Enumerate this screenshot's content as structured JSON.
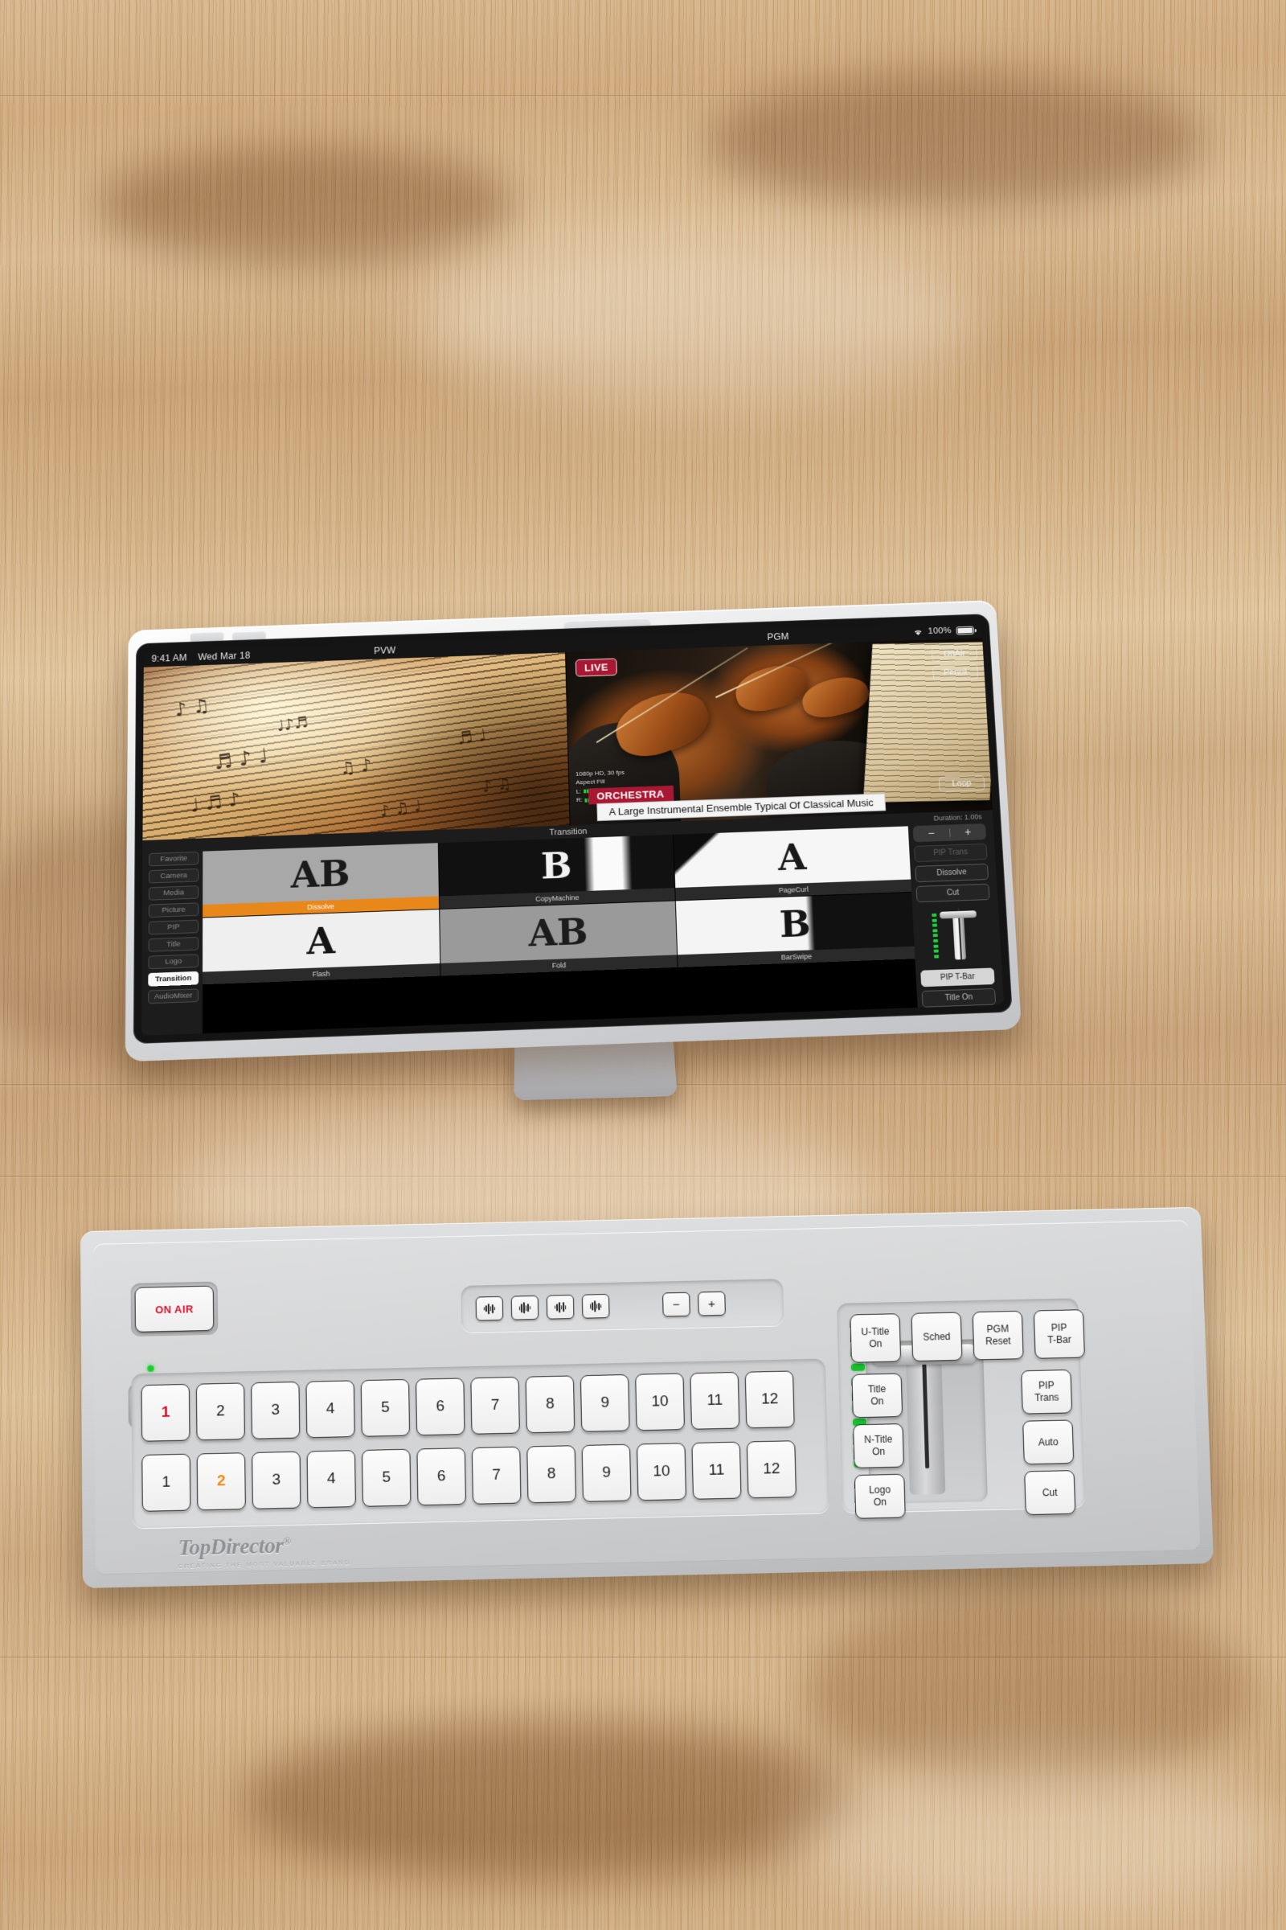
{
  "tablet": {
    "statusbar": {
      "time": "9:41 AM",
      "date": "Wed Mar 18",
      "pvw_label": "PVW",
      "pgm_label": "PGM",
      "battery": "100%",
      "wifi_icon": "wifi-icon",
      "battery_icon": "battery-full-icon"
    },
    "preview": {
      "label": "PVW"
    },
    "program": {
      "live_badge": "LIVE",
      "onair_button": "OnAir",
      "pencil_button": "Pencil",
      "loop_button": "Loop",
      "meta": {
        "format": "1080p HD, 30 fps",
        "aspect": "Aspect Fill",
        "left_channel": "L:",
        "right_channel": "R:"
      },
      "lower_third_title": "ORCHESTRA",
      "lower_third_subtitle": "A Large Instrumental Ensemble Typical Of Classical Music"
    },
    "panel": {
      "title": "Transition",
      "duration_label": "Duration: 1.00s",
      "minus": "−",
      "plus": "+",
      "sidebar": [
        {
          "label": "Favorite",
          "active": false
        },
        {
          "label": "Camera",
          "active": false
        },
        {
          "label": "Media",
          "active": false
        },
        {
          "label": "Picture",
          "active": false
        },
        {
          "label": "PIP",
          "active": false
        },
        {
          "label": "Title",
          "active": false
        },
        {
          "label": "Logo",
          "active": false
        },
        {
          "label": "Transition",
          "active": true
        },
        {
          "label": "AudioMixer",
          "active": false
        }
      ],
      "transitions": [
        {
          "label": "Dissolve",
          "glyph": "AB",
          "selected": true,
          "bg": "#a8a8a8",
          "fg": "#1a1a1a"
        },
        {
          "label": "CopyMachine",
          "glyph": "B",
          "selected": false,
          "bg": "#111111",
          "fg": "#f2f2f2"
        },
        {
          "label": "PageCurl",
          "glyph": "A",
          "selected": false,
          "bg": "#0d0d0d",
          "fg": "#1a1a1a"
        },
        {
          "label": "Flash",
          "glyph": "A",
          "selected": false,
          "bg": "#efefef",
          "fg": "#141414"
        },
        {
          "label": "Fold",
          "glyph": "AB",
          "selected": false,
          "bg": "#9a9a9a",
          "fg": "#1c1c1c"
        },
        {
          "label": "BarSwipe",
          "glyph": "B",
          "selected": false,
          "bg": "#f4f4f4",
          "fg": "#151515"
        }
      ],
      "right_buttons": [
        {
          "label": "PIP Trans",
          "style": "dim"
        },
        {
          "label": "Dissolve",
          "style": "normal"
        },
        {
          "label": "Cut",
          "style": "normal"
        }
      ],
      "tbar_buttons": [
        {
          "label": "PIP T-Bar",
          "style": "light"
        },
        {
          "label": "Title On",
          "style": "normal"
        }
      ],
      "tbar_led_count": 9
    }
  },
  "console": {
    "onair_label": "ON AIR",
    "mid_buttons": [
      {
        "name": "audio-wave-1",
        "label": ""
      },
      {
        "name": "audio-wave-2",
        "label": ""
      },
      {
        "name": "audio-wave-3",
        "label": ""
      },
      {
        "name": "audio-wave-4",
        "label": ""
      }
    ],
    "mid_minus": "−",
    "mid_plus": "+",
    "pgm_row": {
      "name": "pgm-bus",
      "keys": [
        "1",
        "2",
        "3",
        "4",
        "5",
        "6",
        "7",
        "8",
        "9",
        "10",
        "11",
        "12"
      ],
      "active_index": 0,
      "active_color": "#d3112a"
    },
    "pvw_row": {
      "name": "pvw-bus",
      "keys": [
        "1",
        "2",
        "3",
        "4",
        "5",
        "6",
        "7",
        "8",
        "9",
        "10",
        "11",
        "12"
      ],
      "active_index": 1,
      "active_color": "#f08a1a"
    },
    "top_buttons": [
      {
        "line1": "U-Title",
        "line2": "On"
      },
      {
        "line1": "Sched",
        "line2": ""
      },
      {
        "line1": "PGM",
        "line2": "Reset"
      },
      {
        "line1": "PIP",
        "line2": "T-Bar"
      }
    ],
    "left_buttons": [
      {
        "line1": "Title",
        "line2": "On"
      },
      {
        "line1": "N-Title",
        "line2": "On"
      },
      {
        "line1": "Logo",
        "line2": "On"
      }
    ],
    "right_buttons": [
      {
        "line1": "PIP",
        "line2": "Trans"
      },
      {
        "line1": "Auto",
        "line2": ""
      },
      {
        "line1": "Cut",
        "line2": ""
      }
    ],
    "fader_led_count": 9,
    "brand_name": "TopDirector",
    "brand_reg": "®",
    "brand_tagline": "CREATING THE MOST VALUABLE BRAND",
    "jog_icon": "jog-wheel-icon",
    "power_led": "power-led-green"
  },
  "colors": {
    "accent_orange": "#e8881b",
    "live_red": "#a81832",
    "led_green": "#1fd13d",
    "onair_red": "#d3112a"
  }
}
